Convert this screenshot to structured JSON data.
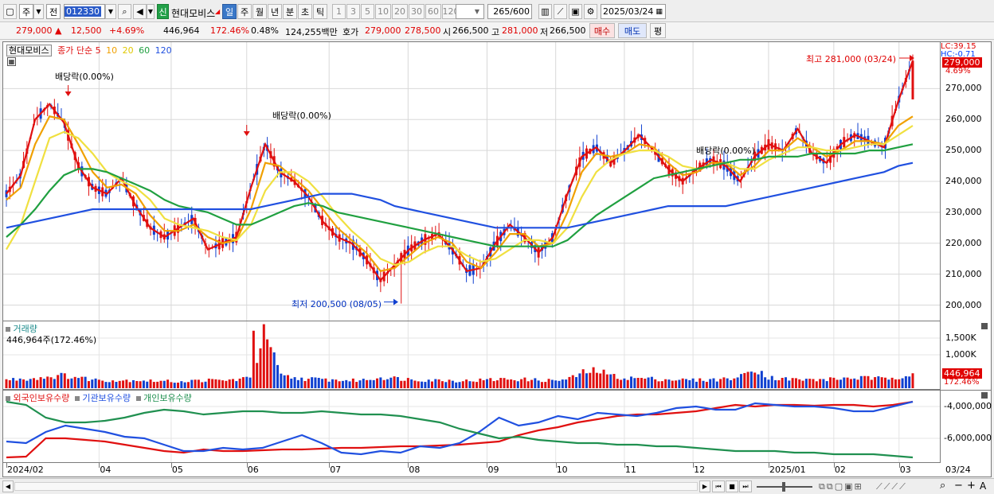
{
  "toolbar": {
    "mode_1": "주",
    "mode_2": "전",
    "code": "012330",
    "badge_new": "신",
    "stock_name": "현대모비스",
    "periods": [
      "일",
      "주",
      "월",
      "년",
      "분",
      "초",
      "틱"
    ],
    "active_period": "일",
    "intervals": [
      "1",
      "3",
      "5",
      "10",
      "20",
      "30",
      "60",
      "120"
    ],
    "count": "265",
    "count_total": "/600",
    "date": "2025/03/24"
  },
  "quote": {
    "price": "279,000",
    "change_arrow": "▲",
    "change": "12,500",
    "change_pct": "+4.69%",
    "volume": "446,964",
    "volume_ratio": "172.46%",
    "turnover": "0.48%",
    "amount": "124,255백만",
    "ask_label": "호가",
    "ask": "279,000",
    "bid": "278,500",
    "open_label": "시",
    "open": "266,500",
    "high_label": "고",
    "high": "281,000",
    "low_label": "저",
    "low": "266,500",
    "buy_button": "매수",
    "sell_button": "매도",
    "eval_button": "평"
  },
  "price_panel": {
    "stock_name": "현대모비스",
    "ma_label": "종가 단순",
    "ma_periods": [
      "5",
      "10",
      "20",
      "60",
      "120"
    ],
    "ma_colors": [
      "#e01010",
      "#f0a000",
      "#f0e040",
      "#20a040",
      "#2050e0"
    ],
    "annotations": {
      "dividend_1": "배당락(0.00%)",
      "dividend_2": "배당락(0.00%)",
      "dividend_3": "배당락(0.00%)",
      "high_note": "최고 281,000 (03/24)",
      "low_note": "최저 200,500 (08/05)"
    },
    "right_tags": {
      "lc": "LC:39.15",
      "hc": "HC:-0.71",
      "price": "279,000",
      "pct": "4.69%"
    }
  },
  "volume_panel": {
    "title": "거래량",
    "value": "446,964주(172.46%)",
    "tag_value": "446,964",
    "tag_pct": "172.46%"
  },
  "holding_panel": {
    "legend": [
      "외국인보유수량",
      "기관보유수량",
      "개인보유수량"
    ],
    "colors": [
      "#e01010",
      "#2050e0",
      "#209050"
    ]
  },
  "x_axis": {
    "labels": [
      "2024/02",
      "04",
      "05",
      "06",
      "07",
      "08",
      "09",
      "10",
      "11",
      "12",
      "2025/01",
      "02",
      "03"
    ],
    "end_label": "03/24"
  },
  "chart_data": [
    {
      "type": "candlestick",
      "title": "현대모비스",
      "ylabel": "",
      "ylim": [
        195000,
        285000
      ],
      "y_ticks": [
        "270,000",
        "260,000",
        "250,000",
        "240,000",
        "230,000",
        "220,000",
        "210,000",
        "200,000"
      ],
      "series": [
        {
          "name": "5",
          "color": "#e01010",
          "values": [
            236000,
            242000,
            260000,
            265000,
            259000,
            245000,
            238000,
            236000,
            241000,
            232000,
            225000,
            222000,
            225000,
            228000,
            218000,
            220000,
            222000,
            238000,
            252000,
            243000,
            240000,
            235000,
            227000,
            222000,
            220000,
            215000,
            208000,
            213000,
            218000,
            221000,
            223000,
            218000,
            211000,
            212000,
            220000,
            226000,
            222000,
            217000,
            222000,
            236000,
            248000,
            251000,
            246000,
            250000,
            255000,
            250000,
            244000,
            240000,
            244000,
            247000,
            245000,
            240000,
            248000,
            252000,
            250000,
            257000,
            249000,
            246000,
            252000,
            255000,
            253000,
            251000,
            266000,
            279000
          ]
        },
        {
          "name": "10",
          "color": "#f0a000",
          "values": [
            234000,
            238000,
            252000,
            261000,
            260000,
            252000,
            243000,
            238000,
            239000,
            236000,
            229000,
            224000,
            224000,
            226000,
            222000,
            220000,
            221000,
            231000,
            246000,
            245000,
            241000,
            237000,
            231000,
            225000,
            221000,
            217000,
            211000,
            212000,
            216000,
            220000,
            222000,
            220000,
            214000,
            212000,
            217000,
            223000,
            223000,
            219000,
            220000,
            230000,
            243000,
            249000,
            248000,
            249000,
            252000,
            251000,
            246000,
            242000,
            243000,
            246000,
            246000,
            242000,
            245000,
            250000,
            250000,
            254000,
            251000,
            248000,
            250000,
            253000,
            253000,
            252000,
            258000,
            261000
          ]
        },
        {
          "name": "20",
          "color": "#f0e040",
          "values": [
            218000,
            226000,
            240000,
            254000,
            256000,
            254000,
            249000,
            243000,
            240000,
            238000,
            234000,
            228000,
            226000,
            225000,
            224000,
            222000,
            221000,
            226000,
            237000,
            243000,
            243000,
            240000,
            235000,
            229000,
            224000,
            220000,
            215000,
            213000,
            214000,
            217000,
            219000,
            219000,
            216000,
            214000,
            215000,
            218000,
            221000,
            221000,
            220000,
            225000,
            235000,
            243000,
            247000,
            249000,
            250000,
            250000,
            248000,
            245000,
            244000,
            245000,
            246000,
            244000,
            244000,
            247000,
            249000,
            251000,
            251000,
            250000,
            250000,
            251000,
            252000,
            252000,
            255000,
            258000
          ]
        },
        {
          "name": "60",
          "color": "#20a040",
          "values": [
            222000,
            226000,
            231000,
            237000,
            242000,
            244000,
            244000,
            243000,
            241000,
            239000,
            237000,
            234000,
            232000,
            231000,
            230000,
            228000,
            226000,
            226000,
            228000,
            230000,
            232000,
            233000,
            232000,
            230000,
            229000,
            228000,
            227000,
            226000,
            225000,
            224000,
            223000,
            222000,
            221000,
            220000,
            219000,
            219000,
            219000,
            219000,
            219000,
            221000,
            225000,
            229000,
            232000,
            235000,
            238000,
            241000,
            242000,
            243000,
            244000,
            245000,
            246000,
            247000,
            247000,
            248000,
            248000,
            248000,
            249000,
            249000,
            249000,
            249000,
            250000,
            250000,
            251000,
            252000
          ]
        },
        {
          "name": "120",
          "color": "#2050e0",
          "values": [
            225000,
            226000,
            227000,
            228000,
            229000,
            230000,
            231000,
            231000,
            231000,
            231000,
            231000,
            231000,
            231000,
            231000,
            231000,
            231000,
            231000,
            231000,
            232000,
            233000,
            234000,
            235000,
            236000,
            236000,
            236000,
            235000,
            234000,
            232000,
            231000,
            230000,
            229000,
            228000,
            227000,
            226000,
            225000,
            225000,
            225000,
            225000,
            225000,
            225000,
            226000,
            227000,
            228000,
            229000,
            230000,
            231000,
            232000,
            232000,
            232000,
            232000,
            232000,
            233000,
            234000,
            235000,
            236000,
            237000,
            238000,
            239000,
            240000,
            241000,
            242000,
            243000,
            245000,
            246000
          ]
        }
      ],
      "high": 281000,
      "low": 200500
    },
    {
      "type": "bar",
      "title": "거래량",
      "ylabel": "",
      "y_ticks": [
        "1,500K",
        "1,000K"
      ],
      "ylim": [
        0,
        2000000
      ],
      "values": [
        250000,
        280000,
        300000,
        350000,
        380000,
        320000,
        260000,
        240000,
        230000,
        250000,
        220000,
        210000,
        200000,
        220000,
        240000,
        230000,
        260000,
        300000,
        1720000,
        380000,
        300000,
        280000,
        260000,
        240000,
        230000,
        250000,
        330000,
        300000,
        270000,
        250000,
        240000,
        230000,
        220000,
        240000,
        260000,
        280000,
        260000,
        240000,
        230000,
        260000,
        450000,
        540000,
        380000,
        300000,
        300000,
        280000,
        260000,
        250000,
        240000,
        250000,
        280000,
        330000,
        620000,
        320000,
        280000,
        260000,
        250000,
        260000,
        290000,
        310000,
        300000,
        280000,
        350000,
        446964
      ]
    },
    {
      "type": "line",
      "title": "외국인보유수량 · 기관보유수량 · 개인보유수량",
      "ylabel": "",
      "y_ticks": [
        "-4,000,000",
        "-6,000,000"
      ],
      "ylim": [
        -7500000,
        -3000000
      ],
      "series": [
        {
          "name": "외국인보유수량",
          "color": "#e01010",
          "values": [
            -7200000,
            -7150000,
            -6000000,
            -6000000,
            -6100000,
            -6200000,
            -6400000,
            -6600000,
            -6800000,
            -6900000,
            -6700000,
            -6800000,
            -6800000,
            -6750000,
            -6700000,
            -6700000,
            -6650000,
            -6600000,
            -6600000,
            -6550000,
            -6500000,
            -6500000,
            -6450000,
            -6400000,
            -6300000,
            -6200000,
            -5800000,
            -5500000,
            -5300000,
            -5000000,
            -4800000,
            -4600000,
            -4500000,
            -4500000,
            -4400000,
            -4300000,
            -4100000,
            -3900000,
            -4000000,
            -3900000,
            -3900000,
            -3950000,
            -3900000,
            -3900000,
            -4000000,
            -3900000,
            -3700000
          ]
        },
        {
          "name": "기관보유수량",
          "color": "#2050e0",
          "values": [
            -6200000,
            -6300000,
            -5600000,
            -5200000,
            -5400000,
            -5600000,
            -5900000,
            -6000000,
            -6400000,
            -6800000,
            -6800000,
            -6600000,
            -6700000,
            -6600000,
            -6200000,
            -5800000,
            -6300000,
            -6900000,
            -7000000,
            -6800000,
            -6900000,
            -6500000,
            -6600000,
            -6300000,
            -5600000,
            -4700000,
            -5200000,
            -5000000,
            -4600000,
            -4800000,
            -4400000,
            -4500000,
            -4600000,
            -4400000,
            -4100000,
            -4000000,
            -4200000,
            -4200000,
            -3800000,
            -3900000,
            -4000000,
            -4000000,
            -4100000,
            -4300000,
            -4300000,
            -4000000,
            -3700000
          ]
        },
        {
          "name": "개인보유수량",
          "color": "#209050",
          "values": [
            -3700000,
            -3900000,
            -4700000,
            -5000000,
            -5000000,
            -4900000,
            -4700000,
            -4400000,
            -4200000,
            -4300000,
            -4500000,
            -4400000,
            -4300000,
            -4300000,
            -4400000,
            -4400000,
            -4300000,
            -4400000,
            -4500000,
            -4500000,
            -4600000,
            -4800000,
            -5000000,
            -5400000,
            -5700000,
            -6000000,
            -5900000,
            -6100000,
            -6200000,
            -6300000,
            -6300000,
            -6400000,
            -6400000,
            -6500000,
            -6500000,
            -6600000,
            -6700000,
            -6800000,
            -6800000,
            -6800000,
            -6900000,
            -6900000,
            -7000000,
            -7000000,
            -7000000,
            -7100000,
            -7200000
          ]
        }
      ]
    }
  ]
}
